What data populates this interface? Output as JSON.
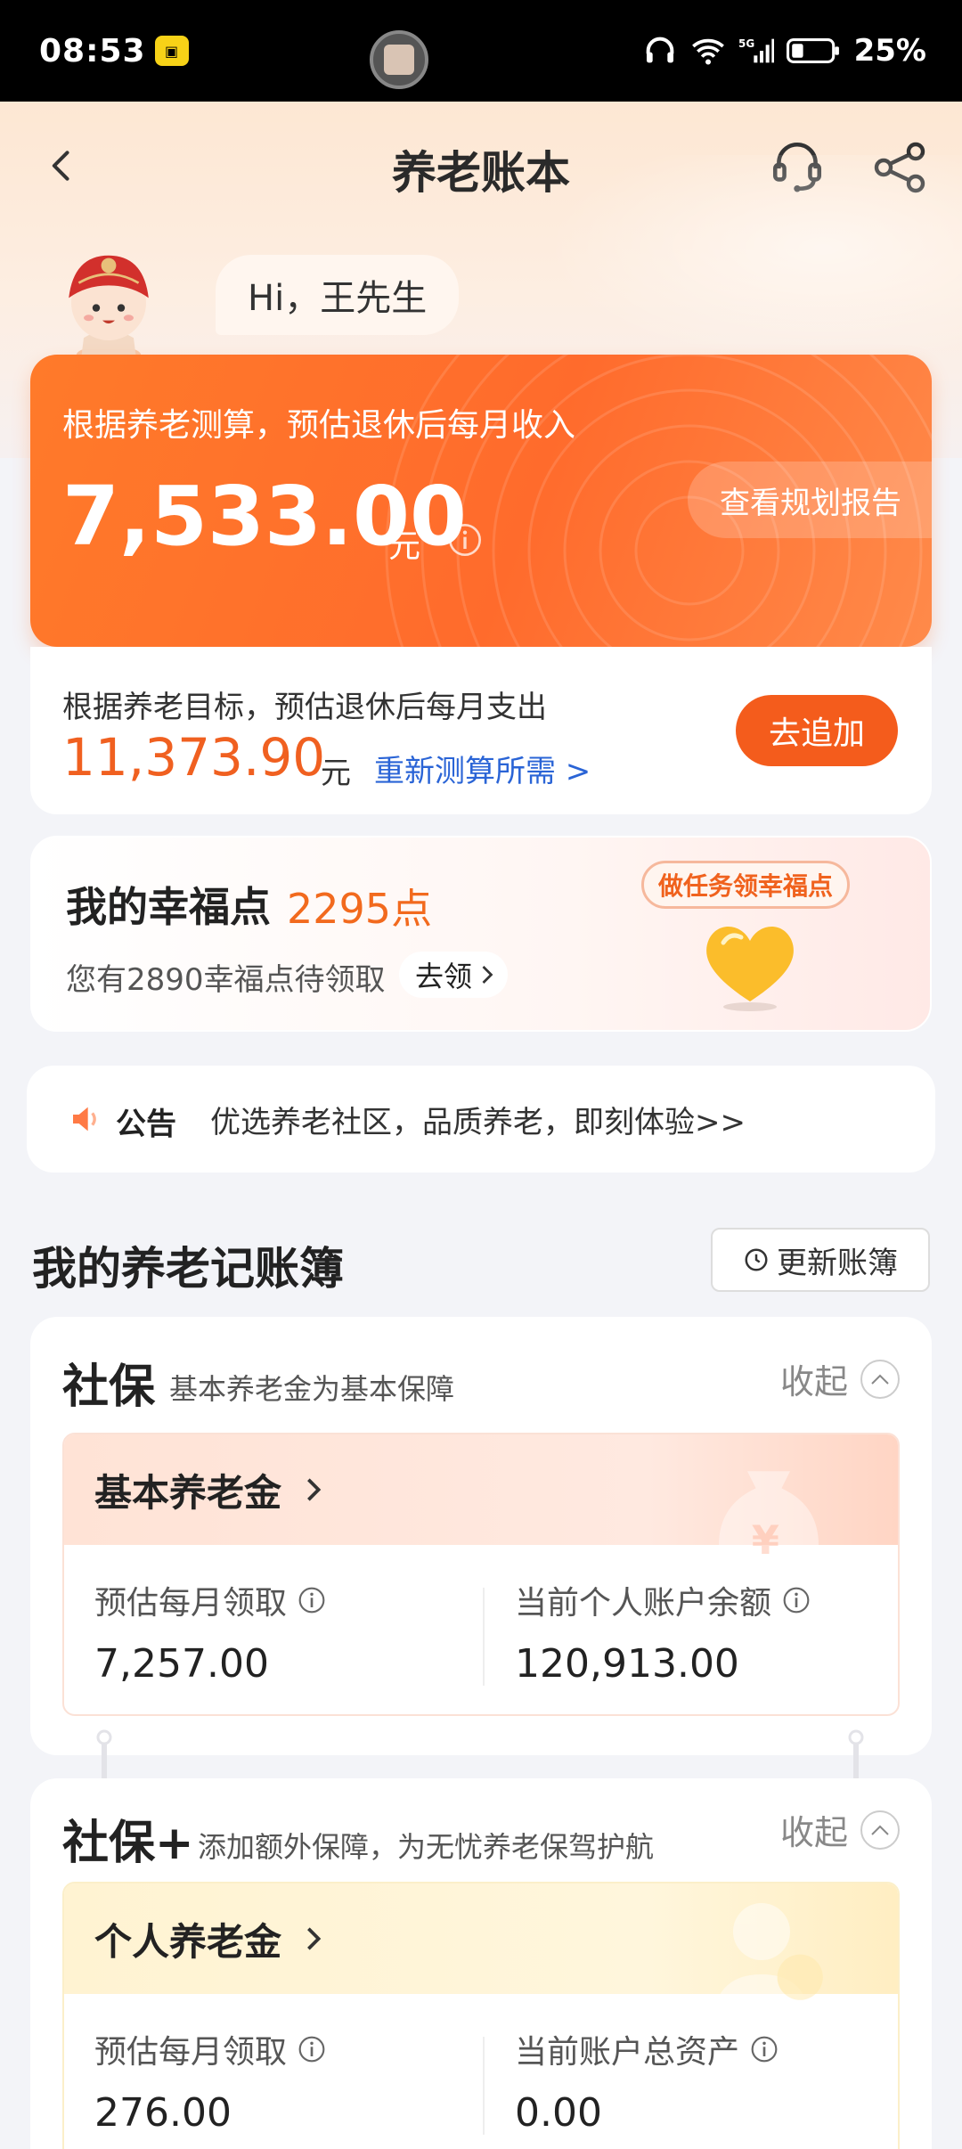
{
  "status_bar": {
    "time": "08:53",
    "battery": "25%",
    "network": "5G"
  },
  "nav": {
    "title": "养老账本"
  },
  "greeting": "Hi，王先生",
  "income": {
    "label": "根据养老测算，预估退休后每月收入",
    "amount": "7,533.00",
    "unit": "元",
    "plan_button": "查看规划报告"
  },
  "expense": {
    "label": "根据养老目标，预估退休后每月支出",
    "amount": "11,373.90",
    "unit": "元",
    "recalc_link": "重新测算所需 >",
    "add_button": "去追加"
  },
  "points": {
    "title": "我的幸福点",
    "value": "2295点",
    "pending": "您有2890幸福点待领取",
    "claim_button": "去领",
    "task_bubble": "做任务领幸福点"
  },
  "notice": {
    "tag": "公告",
    "text": "优选养老社区，品质养老，即刻体验>>"
  },
  "ledger": {
    "title": "我的养老记账簿",
    "update_button": "更新账簿"
  },
  "social_security": {
    "title": "社保",
    "subtitle": "基本养老金为基本保障",
    "collapse": "收起",
    "item_title": "基本养老金",
    "left_label": "预估每月领取",
    "left_value": "7,257.00",
    "right_label": "当前个人账户余额",
    "right_value": "120,913.00",
    "accent": "#ffe3d6"
  },
  "social_security_plus": {
    "title": "社保+",
    "subtitle": "添加额外保障，为无忧养老保驾护航",
    "collapse": "收起",
    "item_title": "个人养老金",
    "left_label": "预估每月领取",
    "left_value": "276.00",
    "right_label": "当前账户总资产",
    "right_value": "0.00",
    "accent": "#fff3d2"
  },
  "colors": {
    "primary": "#ff6b2c",
    "link": "#2a64d6"
  }
}
